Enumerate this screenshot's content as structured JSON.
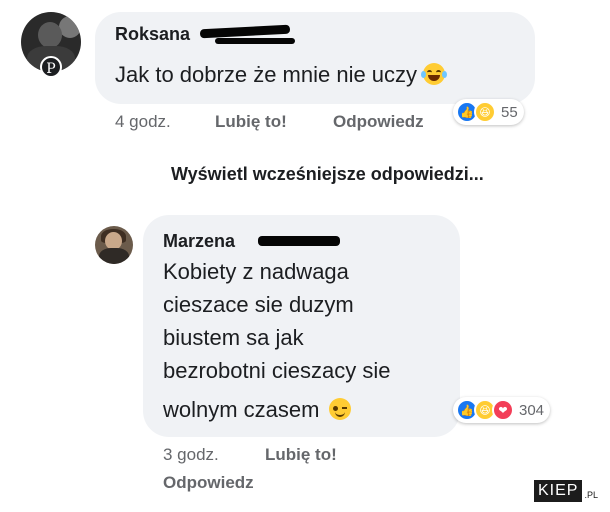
{
  "comments": [
    {
      "author": "Roksana",
      "text": "Jak to dobrze że mnie nie uczy",
      "emoji": "face-with-tears-of-joy",
      "time": "4 godz.",
      "like_label": "Lubię to!",
      "reply_label": "Odpowiedz",
      "reactions": [
        "like",
        "haha"
      ],
      "reaction_count": "55"
    },
    {
      "author": "Marzena",
      "text_lines": [
        "Kobiety z nadwaga",
        "cieszace sie duzym",
        "biustem sa jak",
        "bezrobotni cieszacy sie",
        "wolnym czasem"
      ],
      "emoji": "winking-face",
      "time": "3 godz.",
      "like_label": "Lubię to!",
      "reply_label": "Odpowiedz",
      "reactions": [
        "like",
        "haha",
        "love"
      ],
      "reaction_count": "304"
    }
  ],
  "view_more_replies": "Wyświetl wcześniejsze odpowiedzi...",
  "badge_letter": "P",
  "watermark": {
    "main": "KIEP",
    "suffix": ".PL"
  },
  "colors": {
    "bubble": "#f0f2f5",
    "like": "#1877f2",
    "love": "#f33e58",
    "haha": "#ffcc33",
    "meta": "#65676b"
  }
}
